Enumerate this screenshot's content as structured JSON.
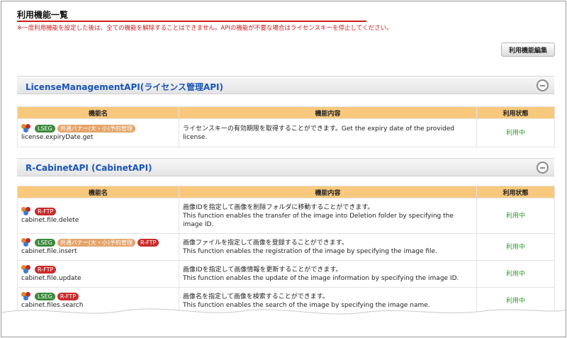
{
  "page": {
    "title": "利用機能一覧",
    "notice": "※一度利用機能を設定した後は、全ての機能を解除することはできません。APIの機能が不要な場合はライセンスキーを停止してください。",
    "edit_button": "利用機能編集"
  },
  "table_headers": {
    "name": "機能名",
    "desc": "機能内容",
    "status": "利用状態"
  },
  "badges": {
    "lseg": "LSEG",
    "shared": "共通バナー(大・小)予約管理",
    "rftp": "R-FTP"
  },
  "sections": [
    {
      "title": "LicenseManagementAPI(ライセンス管理API)",
      "rows": [
        {
          "name": "license.expiryDate.get",
          "desc1": "ライセンスキーの有効期限を取得することができます。Get the expiry date of the provided",
          "desc2": "license.",
          "desc3": "",
          "status": "利用中"
        }
      ]
    },
    {
      "title": "R-CabinetAPI (CabinetAPI)",
      "rows": [
        {
          "name": "cabinet.file.delete",
          "desc1": "画像IDを指定して画像を削除フォルダに移動することができます。",
          "desc2": "This function enables the transfer of the image into Deletion folder by specifying the",
          "desc3": "image ID.",
          "status": "利用中"
        },
        {
          "name": "cabinet.file.insert",
          "desc1": "画像ファイルを指定して画像を登録することができます。",
          "desc2": "This function enables the registration of the image by specifying the image file.",
          "desc3": "",
          "status": "利用中"
        },
        {
          "name": "cabinet.file.update",
          "desc1": "画像IDを指定して画像情報を更新することができます。",
          "desc2": "This function enables the update of the image information by specifying the image ID.",
          "desc3": "",
          "status": "利用中"
        },
        {
          "name": "cabinet.files.search",
          "desc1": "画像名を指定して画像を検索することができます。",
          "desc2": "This function enables the search of the image by specifying the image name.",
          "desc3": "",
          "status": "利用中"
        }
      ]
    }
  ],
  "colors": {
    "accent_red": "#cc1d1d",
    "link_blue": "#1a56b8",
    "header_orange": "#f8c97d",
    "status_green": "#2b9a2b"
  }
}
